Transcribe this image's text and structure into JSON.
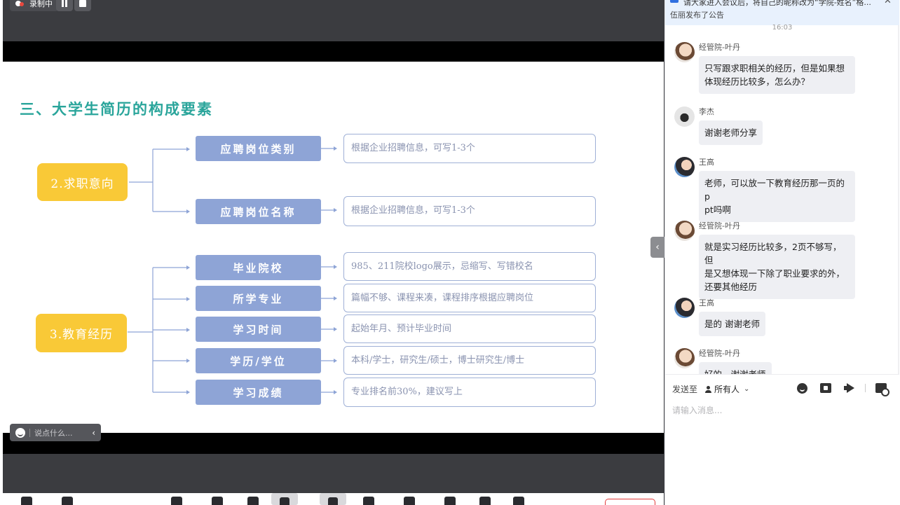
{
  "recording": {
    "label": "录制中"
  },
  "slide": {
    "title": "三、大学生简历的构成要素",
    "sections": [
      {
        "label": "2.求职意向",
        "items": [
          {
            "name": "应聘岗位类别",
            "desc": "根据企业招聘信息，可写1-3个"
          },
          {
            "name": "应聘岗位名称",
            "desc": "根据企业招聘信息，可写1-3个"
          }
        ]
      },
      {
        "label": "3.教育经历",
        "items": [
          {
            "name": "毕业院校",
            "desc": "985、211院校logo展示，忌缩写、写错校名"
          },
          {
            "name": "所学专业",
            "desc": "篇幅不够、课程来凑，课程排序根据应聘岗位"
          },
          {
            "name": "学习时间",
            "desc": "起始年月、预计毕业时间"
          },
          {
            "name": "学历/学位",
            "desc": "本科/学士，研究生/硕士，博士研究生/博士"
          },
          {
            "name": "学习成绩",
            "desc": "专业排名前30%，建议写上"
          }
        ]
      }
    ]
  },
  "say_bar": {
    "placeholder": "说点什么..."
  },
  "chat": {
    "notice_text": "请大家进入会议后，将自己的昵称改为“学院-姓名”格...",
    "notice_sub": "伍丽发布了公告",
    "time": "16:03",
    "messages": [
      {
        "sender": "经管院-叶丹",
        "text_lines": [
          "只写跟求职相关的经历，但是如果想",
          "体现经历比较多，怎么办？"
        ]
      },
      {
        "sender": "李杰",
        "text_lines": [
          "谢谢老师分享"
        ]
      },
      {
        "sender": "王高",
        "text_lines": [
          "老师，可以放一下教育经历那一页的p",
          "pt吗啊"
        ]
      },
      {
        "sender": "经管院-叶丹",
        "text_lines": [
          "就是实习经历比较多，2页不够写，但",
          "是又想体现一下除了职业要求的外，",
          "还要其他经历"
        ]
      },
      {
        "sender": "王高",
        "text_lines": [
          "是的 谢谢老师"
        ]
      },
      {
        "sender": "经管院-叶丹",
        "text_lines": [
          "好的，谢谢老师"
        ]
      }
    ],
    "send_to_label": "发送至",
    "recipient": "所有人",
    "input_placeholder": "请输入消息..."
  }
}
